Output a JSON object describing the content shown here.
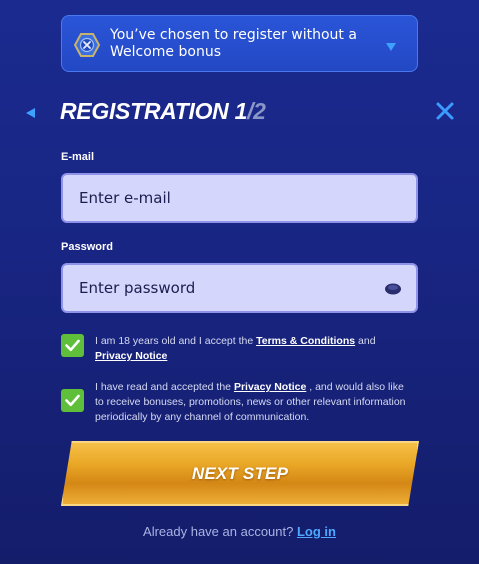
{
  "bonus_banner": {
    "text": "You’ve chosen to register without a Welcome bonus",
    "icon": "no-bonus-icon",
    "toggle_icon": "chevron-down-icon"
  },
  "header": {
    "title": "REGISTRATION 1",
    "step_separator": "/",
    "step_total": "2",
    "back_icon": "back-arrow-icon",
    "close_icon": "close-icon"
  },
  "form": {
    "email": {
      "label": "E-mail",
      "placeholder": "Enter e-mail",
      "value": ""
    },
    "password": {
      "label": "Password",
      "placeholder": "Enter password",
      "value": "",
      "eye_icon": "eye-icon"
    }
  },
  "consents": [
    {
      "checked": true,
      "text_before": "I am 18 years old and I accept the ",
      "link1": "Terms & Conditions",
      "text_mid": " and ",
      "link2": "Privacy Notice"
    },
    {
      "checked": true,
      "text_before": "I have read and accepted the ",
      "link1": "Privacy Notice",
      "text_after": " , and would also like to receive bonuses, promotions, news or other relevant information periodically by any channel of communication."
    }
  ],
  "next_button": {
    "label": "NEXT STEP"
  },
  "footer": {
    "prompt": "Already have an account? ",
    "login_link": "Log in"
  },
  "colors": {
    "background": "#1a2a8f",
    "banner": "#2a55d8",
    "input_bg": "#d4d6fb",
    "checkbox": "#5fbf3a",
    "button_gold": "#eaa827",
    "link_blue": "#4fa8ff",
    "close_blue": "#3b9bff"
  }
}
